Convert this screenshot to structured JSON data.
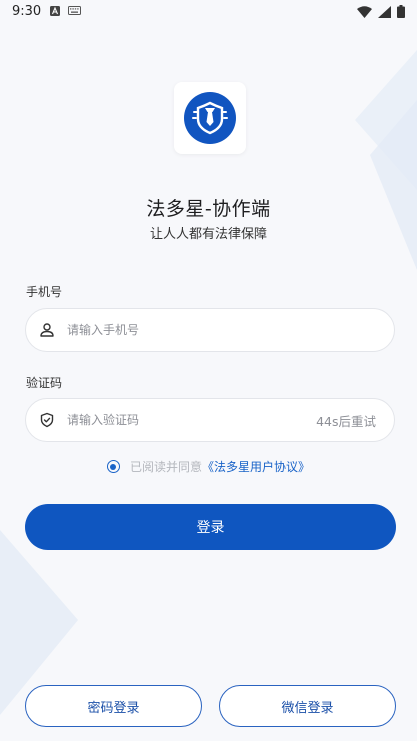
{
  "status_bar": {
    "time": "9:30",
    "left_icons": [
      "notification-a-icon",
      "keyboard-icon"
    ],
    "right_icons": [
      "wifi-icon",
      "signal-icon",
      "battery-icon"
    ]
  },
  "app": {
    "title": "法多星-协作端",
    "subtitle": "让人人都有法律保障"
  },
  "phone": {
    "label": "手机号",
    "placeholder": "请输入手机号",
    "value": ""
  },
  "code": {
    "label": "验证码",
    "placeholder": "请输入验证码",
    "value": "",
    "resend_label": "44s后重试"
  },
  "agreement": {
    "checked": true,
    "text": "已阅读并同意",
    "link": "《法多星用户协议》"
  },
  "login_button": "登录",
  "alt_login": {
    "password": "密码登录",
    "wechat": "微信登录"
  },
  "colors": {
    "primary": "#0f56c0",
    "link": "#1963c8",
    "background": "#f7f8fb"
  }
}
